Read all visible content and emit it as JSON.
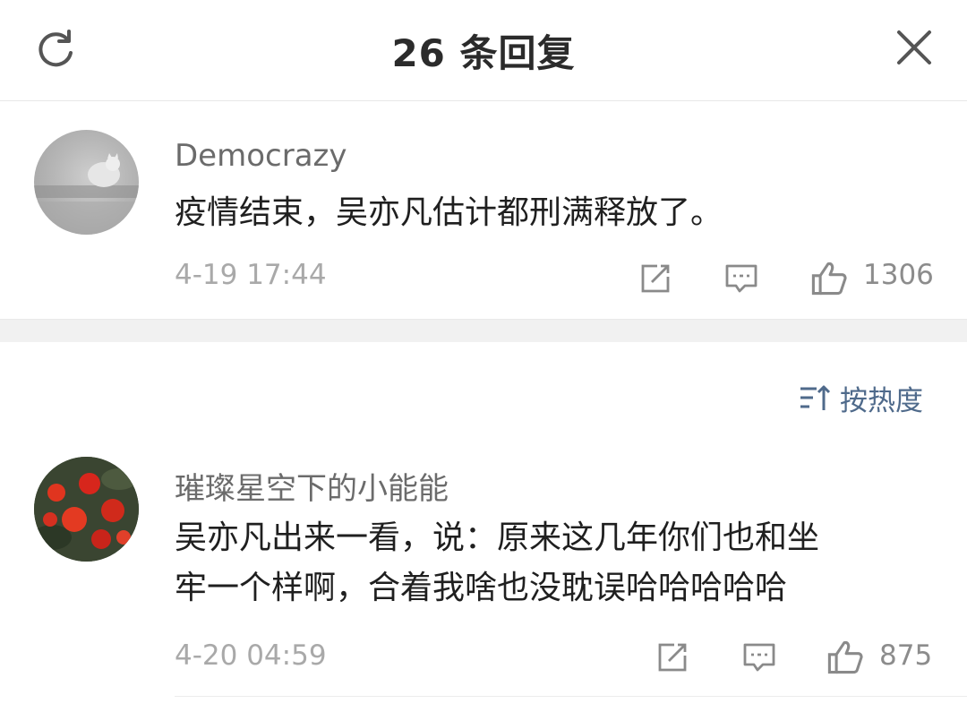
{
  "header": {
    "title": "26 条回复",
    "refresh_icon": "refresh-icon",
    "close_icon": "close-icon"
  },
  "comments": [
    {
      "username": "Democrazy",
      "content": "疫情结束，吴亦凡估计都刑满释放了。",
      "time": "4-19 17:44",
      "likes": "1306",
      "icons": [
        "share-icon",
        "reply-icon",
        "thumbs-up-icon"
      ]
    },
    {
      "username": "璀璨星空下的小能能",
      "content_lines": [
        "吴亦凡出来一看，说：原来这几年你们也和坐",
        "牢一个样啊，合着我啥也没耽误哈哈哈哈哈"
      ],
      "time": "4-20 04:59",
      "likes": "875",
      "icons": [
        "share-icon",
        "reply-icon",
        "thumbs-up-icon"
      ]
    }
  ],
  "sort": {
    "label": "按热度",
    "icon": "sort-icon"
  },
  "colors": {
    "accent": "#4f6a8b",
    "meta": "#a9a9a9",
    "text": "#1f1f1f",
    "separator": "#f1f1f1"
  }
}
